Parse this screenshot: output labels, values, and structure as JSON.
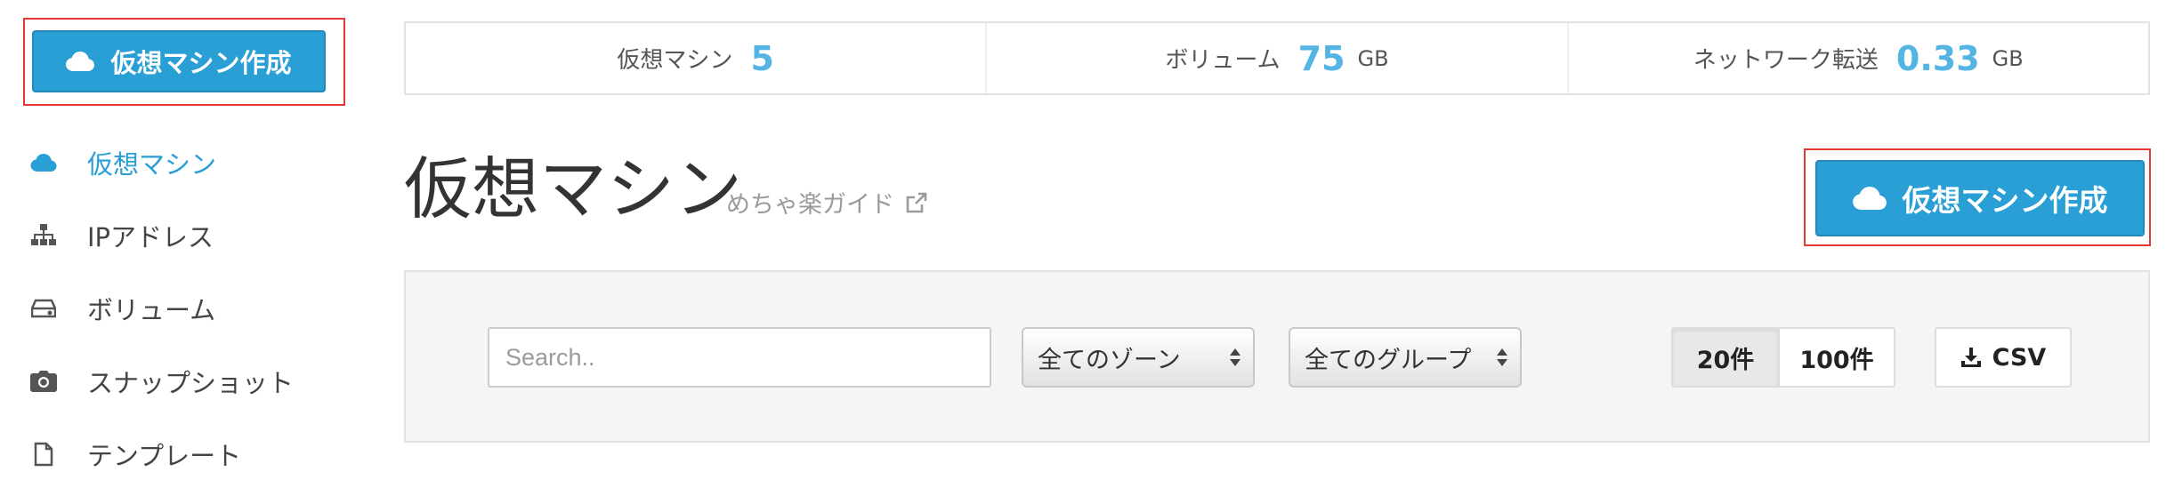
{
  "sidebar": {
    "create_button_label": "仮想マシン作成",
    "items": [
      {
        "label": "仮想マシン",
        "icon": "cloud-icon",
        "active": true
      },
      {
        "label": "IPアドレス",
        "icon": "sitemap-icon",
        "active": false
      },
      {
        "label": "ボリューム",
        "icon": "hdd-icon",
        "active": false
      },
      {
        "label": "スナップショット",
        "icon": "camera-icon",
        "active": false
      },
      {
        "label": "テンプレート",
        "icon": "file-icon",
        "active": false
      }
    ]
  },
  "stats": [
    {
      "label": "仮想マシン",
      "value": "5",
      "unit": ""
    },
    {
      "label": "ボリューム",
      "value": "75",
      "unit": "GB"
    },
    {
      "label": "ネットワーク転送",
      "value": "0.33",
      "unit": "GB"
    }
  ],
  "header": {
    "title": "仮想マシン",
    "guide_link": "めちゃ楽ガイド",
    "create_button_label": "仮想マシン作成"
  },
  "filters": {
    "search_placeholder": "Search..",
    "zone_select": "全てのゾーン",
    "group_select": "全てのグループ",
    "page_sizes": [
      {
        "label": "20件",
        "active": true
      },
      {
        "label": "100件",
        "active": false
      }
    ],
    "csv_label": "CSV"
  },
  "colors": {
    "accent": "#2a9fd6",
    "stat_value": "#54b4e4",
    "highlight": "#e53935"
  }
}
